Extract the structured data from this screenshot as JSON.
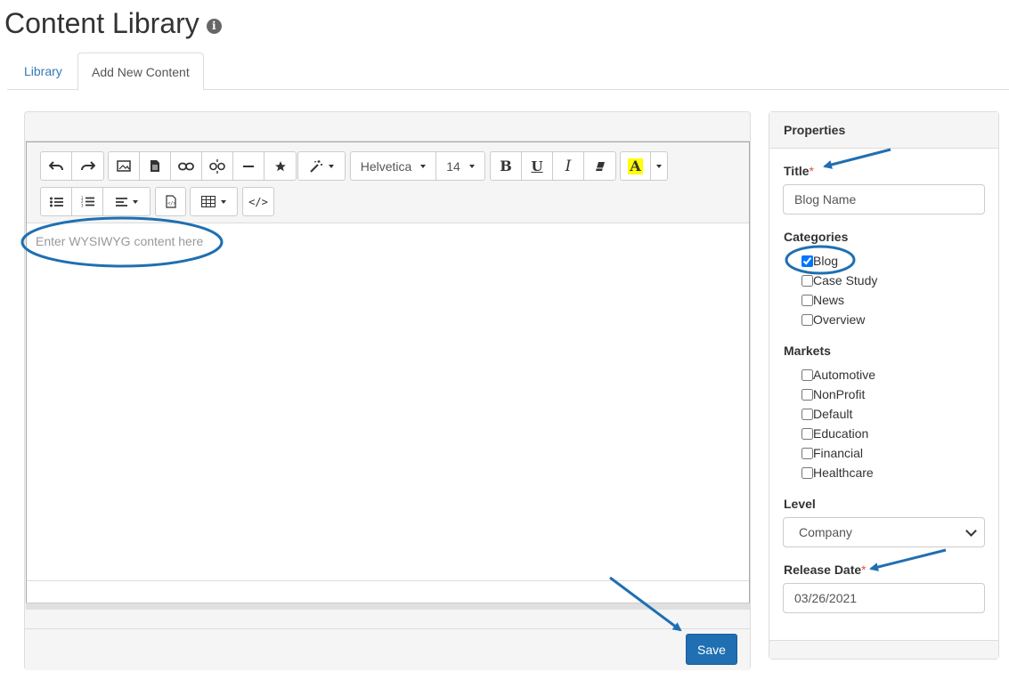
{
  "page": {
    "title": "Content Library"
  },
  "tabs": [
    {
      "label": "Library"
    },
    {
      "label": "Add New Content"
    }
  ],
  "editor": {
    "font_family": "Helvetica",
    "font_size": "14",
    "placeholder": "Enter WYSIWYG content here",
    "save_label": "Save",
    "toolbar_icons": [
      "undo-icon",
      "redo-icon",
      "image-icon",
      "document-icon",
      "link-icon",
      "unlink-icon",
      "horizontal-rule-icon",
      "star-icon",
      "magic-wand-icon",
      "bold-icon",
      "underline-icon",
      "italic-icon",
      "eraser-icon",
      "text-color-icon",
      "bullet-list-icon",
      "numbered-list-icon",
      "align-icon",
      "template-icon",
      "table-icon",
      "code-view-icon"
    ]
  },
  "properties": {
    "heading": "Properties",
    "title_label": "Title",
    "title_value": "Blog Name",
    "categories_label": "Categories",
    "categories": [
      {
        "label": "Blog",
        "checked": true
      },
      {
        "label": "Case Study",
        "checked": false
      },
      {
        "label": "News",
        "checked": false
      },
      {
        "label": "Overview",
        "checked": false
      }
    ],
    "markets_label": "Markets",
    "markets": [
      {
        "label": "Automotive",
        "checked": false
      },
      {
        "label": "NonProfit",
        "checked": false
      },
      {
        "label": "Default",
        "checked": false
      },
      {
        "label": "Education",
        "checked": false
      },
      {
        "label": "Financial",
        "checked": false
      },
      {
        "label": "Healthcare",
        "checked": false
      }
    ],
    "level_label": "Level",
    "level_value": "Company",
    "release_label": "Release Date",
    "release_value": "03/26/2021",
    "required_mark": "*"
  },
  "colors": {
    "annotation": "#1f6fb2",
    "link": "#337ab7",
    "primary_button": "#1f6fb2",
    "highlight": "#ffff00"
  }
}
